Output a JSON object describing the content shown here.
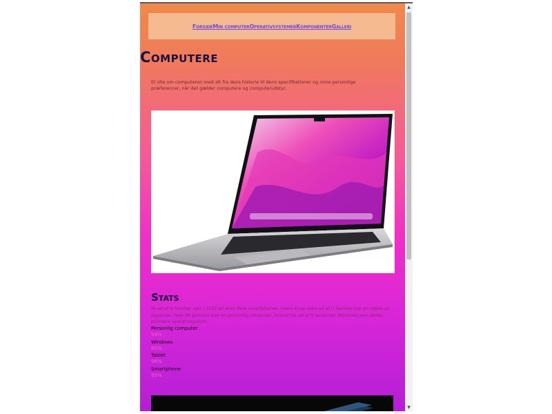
{
  "nav": {
    "links": [
      "Forside",
      "Min computer",
      "Operativsystemer",
      "Komponenter",
      "Galleri"
    ]
  },
  "page_title": "Computere",
  "intro": "Et site om computeren med alt fra dens historie til dens specifikationer og mine personlige præferencer, når det gælder computere og computerudstyr.",
  "stats": {
    "title": "Stats",
    "text": "Ni ud af ti familier ejer i 2022 en eller flere smartphones, mens knap seks ud af ti familier har en tablet-pc liggende. Hele 94 procent ejer en personlig computer, hvoraf tre ud af fi anvender Windows som deres primære operativsystem.",
    "items": [
      {
        "label": "Personlig computer",
        "value": "94%"
      },
      {
        "label": "Windows",
        "value": "60%"
      },
      {
        "label": "Tablet",
        "value": "56%"
      },
      {
        "label": "Smartphone",
        "value": "93%"
      }
    ]
  },
  "colors": {
    "nav_bg": "#f6ba90",
    "link": "#6a48e8",
    "heading": "#1a1040",
    "stat_value": "#e86ac0"
  }
}
